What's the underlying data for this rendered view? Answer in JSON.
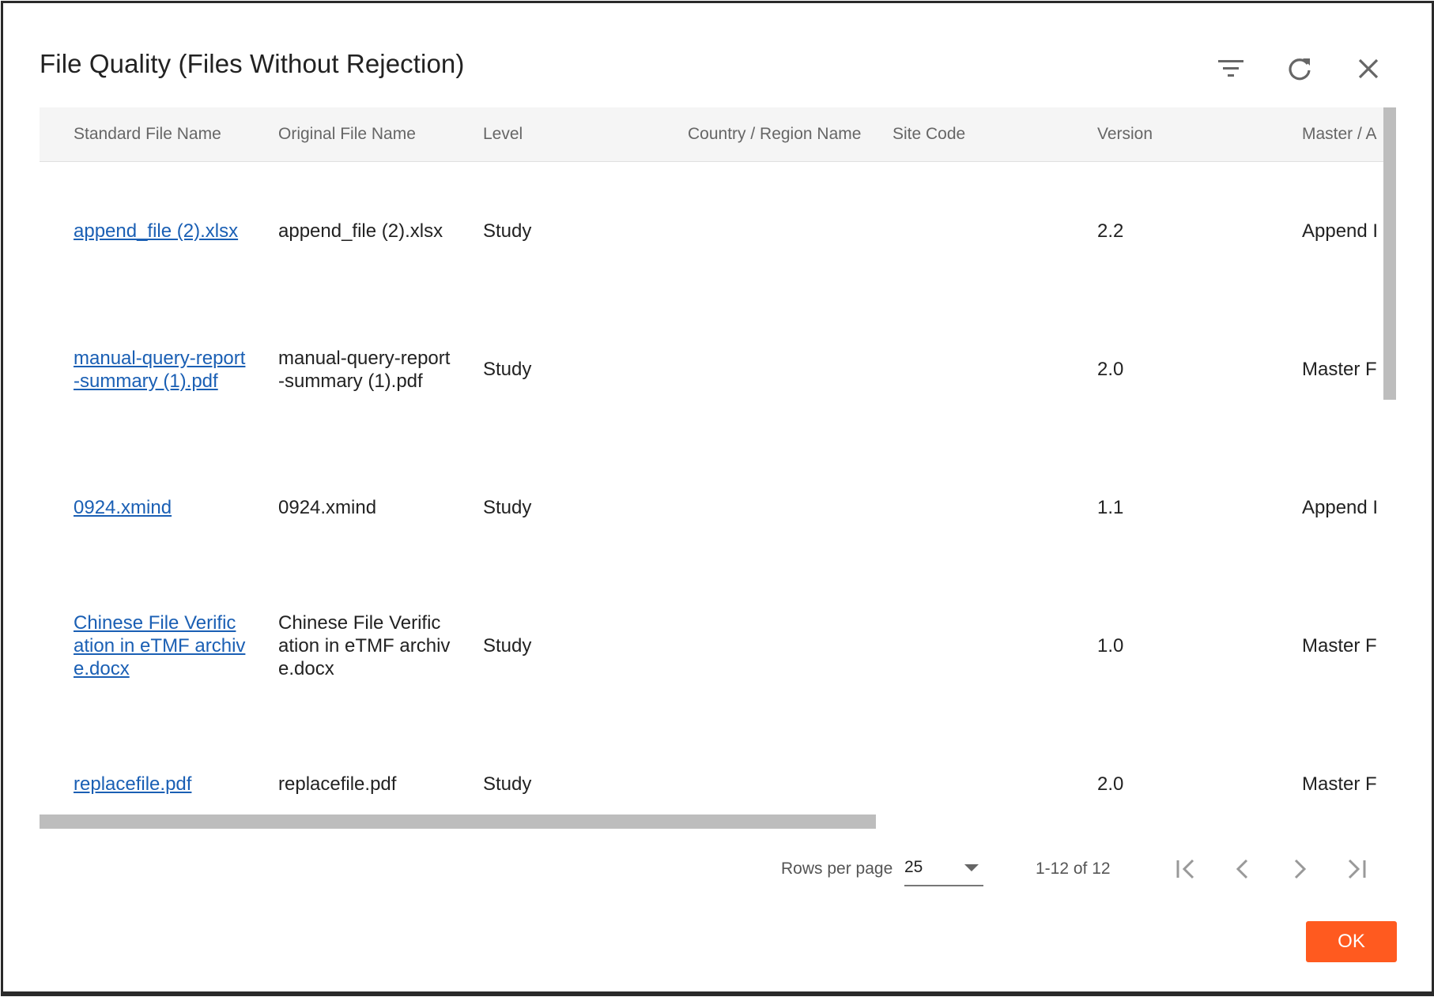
{
  "dialog": {
    "title": "File Quality (Files Without Rejection)",
    "icons": {
      "filter": "filter-icon",
      "refresh": "refresh-icon",
      "close": "close-icon"
    }
  },
  "table": {
    "columns": [
      "Standard File Name",
      "Original File Name",
      "Level",
      "Country / Region Name",
      "Site Code",
      "Version",
      "Master / A"
    ],
    "rows": [
      {
        "standard": "append_file (2).xlsx",
        "original": "append_file (2).xlsx",
        "level": "Study",
        "country": "",
        "site": "",
        "version": "2.2",
        "master": "Append I"
      },
      {
        "standard": "manual-query-report-summary (1).pdf",
        "original": "manual-query-report-summary (1).pdf",
        "level": "Study",
        "country": "",
        "site": "",
        "version": "2.0",
        "master": "Master F"
      },
      {
        "standard": "0924.xmind",
        "original": "0924.xmind",
        "level": "Study",
        "country": "",
        "site": "",
        "version": "1.1",
        "master": "Append I"
      },
      {
        "standard": "Chinese File Verification in eTMF archive.docx",
        "original": "Chinese File Verification in eTMF archive.docx",
        "level": "Study",
        "country": "",
        "site": "",
        "version": "1.0",
        "master": "Master F"
      },
      {
        "standard": "replacefile.pdf",
        "original": "replacefile.pdf",
        "level": "Study",
        "country": "",
        "site": "",
        "version": "2.0",
        "master": "Master F"
      }
    ]
  },
  "pagination": {
    "rows_per_page_label": "Rows per page",
    "rows_per_page_value": "25",
    "range": "1-12 of 12",
    "icons": {
      "first": "first-page-icon",
      "prev": "prev-page-icon",
      "next": "next-page-icon",
      "last": "last-page-icon"
    }
  },
  "footer": {
    "ok_label": "OK"
  },
  "colors": {
    "link": "#1a5fb4",
    "accent": "#ff5a1f",
    "header_bg": "#f5f5f5",
    "scrollbar": "#bdbdbd"
  }
}
